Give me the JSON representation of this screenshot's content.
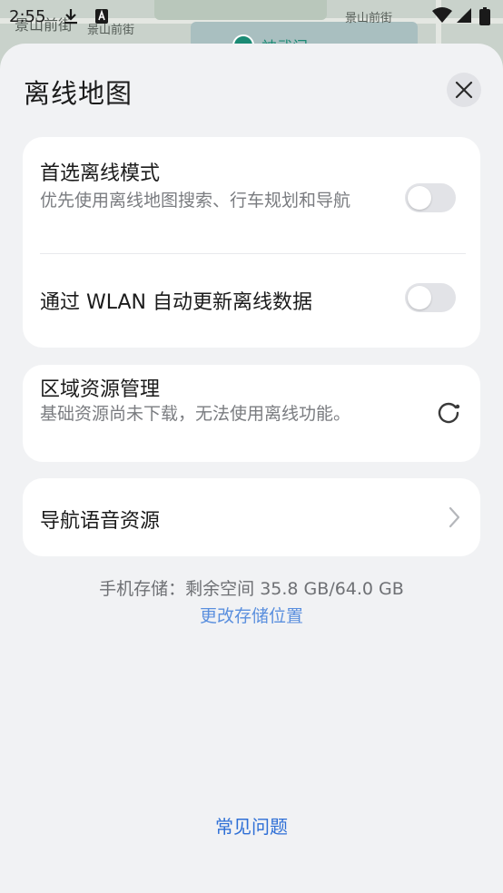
{
  "status_bar": {
    "time": "2:55"
  },
  "map": {
    "street_label_1": "景山前街",
    "street_label_2": "景山前街",
    "street_label_3": "景山前街",
    "poi_label": "神武门"
  },
  "sheet": {
    "title": "离线地图",
    "close_label": "×"
  },
  "settings": {
    "preferred_offline": {
      "title": "首选离线模式",
      "subtitle": "优先使用离线地图搜索、行车规划和导航",
      "enabled": false
    },
    "wlan_update": {
      "title": "通过 WLAN 自动更新离线数据",
      "enabled": false
    },
    "region_resources": {
      "title": "区域资源管理",
      "subtitle": "基础资源尚未下载，无法使用离线功能。"
    },
    "voice_resources": {
      "title": "导航语音资源"
    }
  },
  "storage": {
    "text": "手机存储：剩余空间 35.8 GB/64.0 GB",
    "change_link": "更改存储位置"
  },
  "faq": {
    "label": "常见问题"
  },
  "colors": {
    "accent": "#2e6fd6",
    "link": "#5a8fde",
    "sheet_bg": "#f1f2f4",
    "card_bg": "#ffffff"
  },
  "icons": {
    "close": "close-icon",
    "chevron": "chevron-right-icon",
    "loading": "loading-icon",
    "wifi": "wifi-icon",
    "signal": "signal-icon",
    "battery": "battery-icon",
    "download": "download-icon"
  }
}
